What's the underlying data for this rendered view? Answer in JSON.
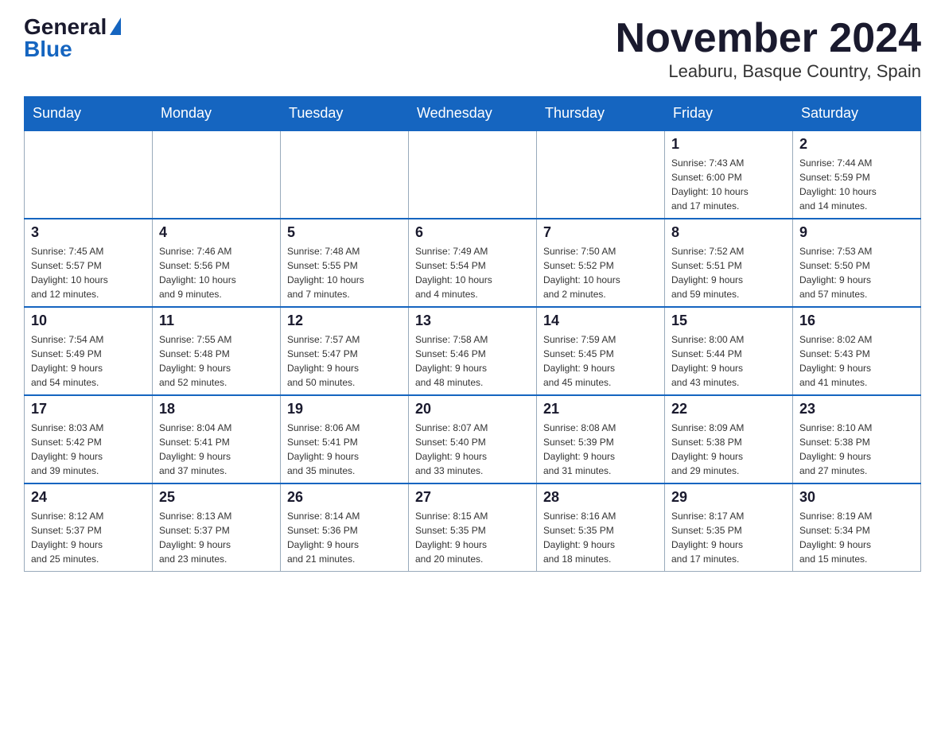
{
  "header": {
    "logo_general": "General",
    "logo_blue": "Blue",
    "title": "November 2024",
    "subtitle": "Leaburu, Basque Country, Spain"
  },
  "weekdays": [
    "Sunday",
    "Monday",
    "Tuesday",
    "Wednesday",
    "Thursday",
    "Friday",
    "Saturday"
  ],
  "weeks": [
    [
      {
        "day": "",
        "info": ""
      },
      {
        "day": "",
        "info": ""
      },
      {
        "day": "",
        "info": ""
      },
      {
        "day": "",
        "info": ""
      },
      {
        "day": "",
        "info": ""
      },
      {
        "day": "1",
        "info": "Sunrise: 7:43 AM\nSunset: 6:00 PM\nDaylight: 10 hours\nand 17 minutes."
      },
      {
        "day": "2",
        "info": "Sunrise: 7:44 AM\nSunset: 5:59 PM\nDaylight: 10 hours\nand 14 minutes."
      }
    ],
    [
      {
        "day": "3",
        "info": "Sunrise: 7:45 AM\nSunset: 5:57 PM\nDaylight: 10 hours\nand 12 minutes."
      },
      {
        "day": "4",
        "info": "Sunrise: 7:46 AM\nSunset: 5:56 PM\nDaylight: 10 hours\nand 9 minutes."
      },
      {
        "day": "5",
        "info": "Sunrise: 7:48 AM\nSunset: 5:55 PM\nDaylight: 10 hours\nand 7 minutes."
      },
      {
        "day": "6",
        "info": "Sunrise: 7:49 AM\nSunset: 5:54 PM\nDaylight: 10 hours\nand 4 minutes."
      },
      {
        "day": "7",
        "info": "Sunrise: 7:50 AM\nSunset: 5:52 PM\nDaylight: 10 hours\nand 2 minutes."
      },
      {
        "day": "8",
        "info": "Sunrise: 7:52 AM\nSunset: 5:51 PM\nDaylight: 9 hours\nand 59 minutes."
      },
      {
        "day": "9",
        "info": "Sunrise: 7:53 AM\nSunset: 5:50 PM\nDaylight: 9 hours\nand 57 minutes."
      }
    ],
    [
      {
        "day": "10",
        "info": "Sunrise: 7:54 AM\nSunset: 5:49 PM\nDaylight: 9 hours\nand 54 minutes."
      },
      {
        "day": "11",
        "info": "Sunrise: 7:55 AM\nSunset: 5:48 PM\nDaylight: 9 hours\nand 52 minutes."
      },
      {
        "day": "12",
        "info": "Sunrise: 7:57 AM\nSunset: 5:47 PM\nDaylight: 9 hours\nand 50 minutes."
      },
      {
        "day": "13",
        "info": "Sunrise: 7:58 AM\nSunset: 5:46 PM\nDaylight: 9 hours\nand 48 minutes."
      },
      {
        "day": "14",
        "info": "Sunrise: 7:59 AM\nSunset: 5:45 PM\nDaylight: 9 hours\nand 45 minutes."
      },
      {
        "day": "15",
        "info": "Sunrise: 8:00 AM\nSunset: 5:44 PM\nDaylight: 9 hours\nand 43 minutes."
      },
      {
        "day": "16",
        "info": "Sunrise: 8:02 AM\nSunset: 5:43 PM\nDaylight: 9 hours\nand 41 minutes."
      }
    ],
    [
      {
        "day": "17",
        "info": "Sunrise: 8:03 AM\nSunset: 5:42 PM\nDaylight: 9 hours\nand 39 minutes."
      },
      {
        "day": "18",
        "info": "Sunrise: 8:04 AM\nSunset: 5:41 PM\nDaylight: 9 hours\nand 37 minutes."
      },
      {
        "day": "19",
        "info": "Sunrise: 8:06 AM\nSunset: 5:41 PM\nDaylight: 9 hours\nand 35 minutes."
      },
      {
        "day": "20",
        "info": "Sunrise: 8:07 AM\nSunset: 5:40 PM\nDaylight: 9 hours\nand 33 minutes."
      },
      {
        "day": "21",
        "info": "Sunrise: 8:08 AM\nSunset: 5:39 PM\nDaylight: 9 hours\nand 31 minutes."
      },
      {
        "day": "22",
        "info": "Sunrise: 8:09 AM\nSunset: 5:38 PM\nDaylight: 9 hours\nand 29 minutes."
      },
      {
        "day": "23",
        "info": "Sunrise: 8:10 AM\nSunset: 5:38 PM\nDaylight: 9 hours\nand 27 minutes."
      }
    ],
    [
      {
        "day": "24",
        "info": "Sunrise: 8:12 AM\nSunset: 5:37 PM\nDaylight: 9 hours\nand 25 minutes."
      },
      {
        "day": "25",
        "info": "Sunrise: 8:13 AM\nSunset: 5:37 PM\nDaylight: 9 hours\nand 23 minutes."
      },
      {
        "day": "26",
        "info": "Sunrise: 8:14 AM\nSunset: 5:36 PM\nDaylight: 9 hours\nand 21 minutes."
      },
      {
        "day": "27",
        "info": "Sunrise: 8:15 AM\nSunset: 5:35 PM\nDaylight: 9 hours\nand 20 minutes."
      },
      {
        "day": "28",
        "info": "Sunrise: 8:16 AM\nSunset: 5:35 PM\nDaylight: 9 hours\nand 18 minutes."
      },
      {
        "day": "29",
        "info": "Sunrise: 8:17 AM\nSunset: 5:35 PM\nDaylight: 9 hours\nand 17 minutes."
      },
      {
        "day": "30",
        "info": "Sunrise: 8:19 AM\nSunset: 5:34 PM\nDaylight: 9 hours\nand 15 minutes."
      }
    ]
  ]
}
